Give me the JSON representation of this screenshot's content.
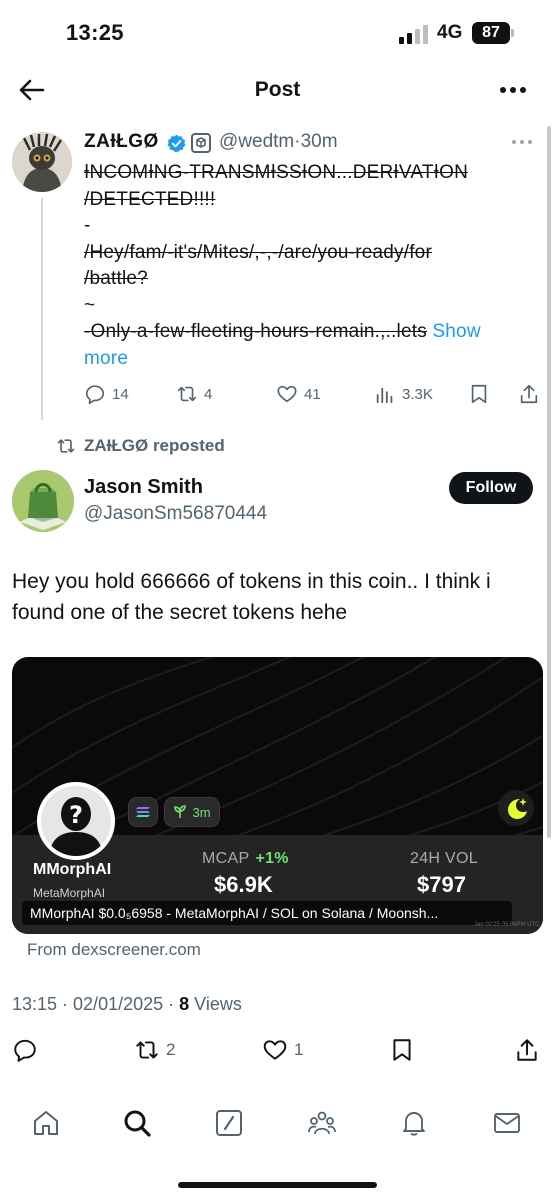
{
  "status_bar": {
    "time": "13:25",
    "network": "4G",
    "battery": "87"
  },
  "header": {
    "title": "Post"
  },
  "quoted_post": {
    "author_name": "ZAƗŁGØ",
    "handle": "@wedtm",
    "time_ago": "30m",
    "text_lines": [
      "ƗNCOMƗNG-TRANSMƗSSƗON...DERƗVATƗON",
      "/DETECTED!!!!",
      "-",
      "/Hey/fam/-it's/Mites/,-,-/are/you-ready/for",
      "/battle?",
      "~",
      "-Only-a-few-fleeting-hours-remain.,..lets"
    ],
    "show_more_inline": "Show",
    "show_more_end": "more",
    "stats": {
      "replies": "14",
      "reposts": "4",
      "likes": "41",
      "views": "3.3K"
    }
  },
  "reposted_label": "ZAƗŁGØ reposted",
  "post": {
    "author_name": "Jason Smith",
    "handle": "@JasonSm56870444",
    "follow_label": "Follow",
    "text": "Hey you hold 666666 of tokens in this coin.. I think i found one of the secret tokens hehe",
    "card": {
      "age_badge": "3m",
      "token_name": "MMorphAI",
      "token_subname": "MetaMorphAI",
      "mcap_label": "MCAP",
      "mcap_change": "+1%",
      "mcap_value": "$6.9K",
      "vol_label": "24H VOL",
      "vol_value": "$797",
      "caption": "MMorphAI $0.0₅6958 - MetaMorphAI / SOL on Solana / Moonsh...",
      "stamp": "Jan 02'25 05:06PM UTC"
    },
    "source": "From dexscreener.com",
    "timestamp": "13:15 · 02/01/2025 · ",
    "views_count": "8",
    "views_label": " Views",
    "stats": {
      "reposts": "2",
      "likes": "1"
    }
  },
  "colors": {
    "link": "#1d9bf0",
    "verified": "#1d9bf0",
    "muted": "#536471",
    "text": "#0f1419"
  },
  "icons": [
    "back-arrow-icon",
    "more-icon",
    "verified-icon",
    "reply-icon",
    "repost-icon",
    "like-icon",
    "views-icon",
    "bookmark-icon",
    "share-icon",
    "home-icon",
    "search-icon",
    "grok-icon",
    "communities-icon",
    "notifications-icon",
    "messages-icon"
  ]
}
